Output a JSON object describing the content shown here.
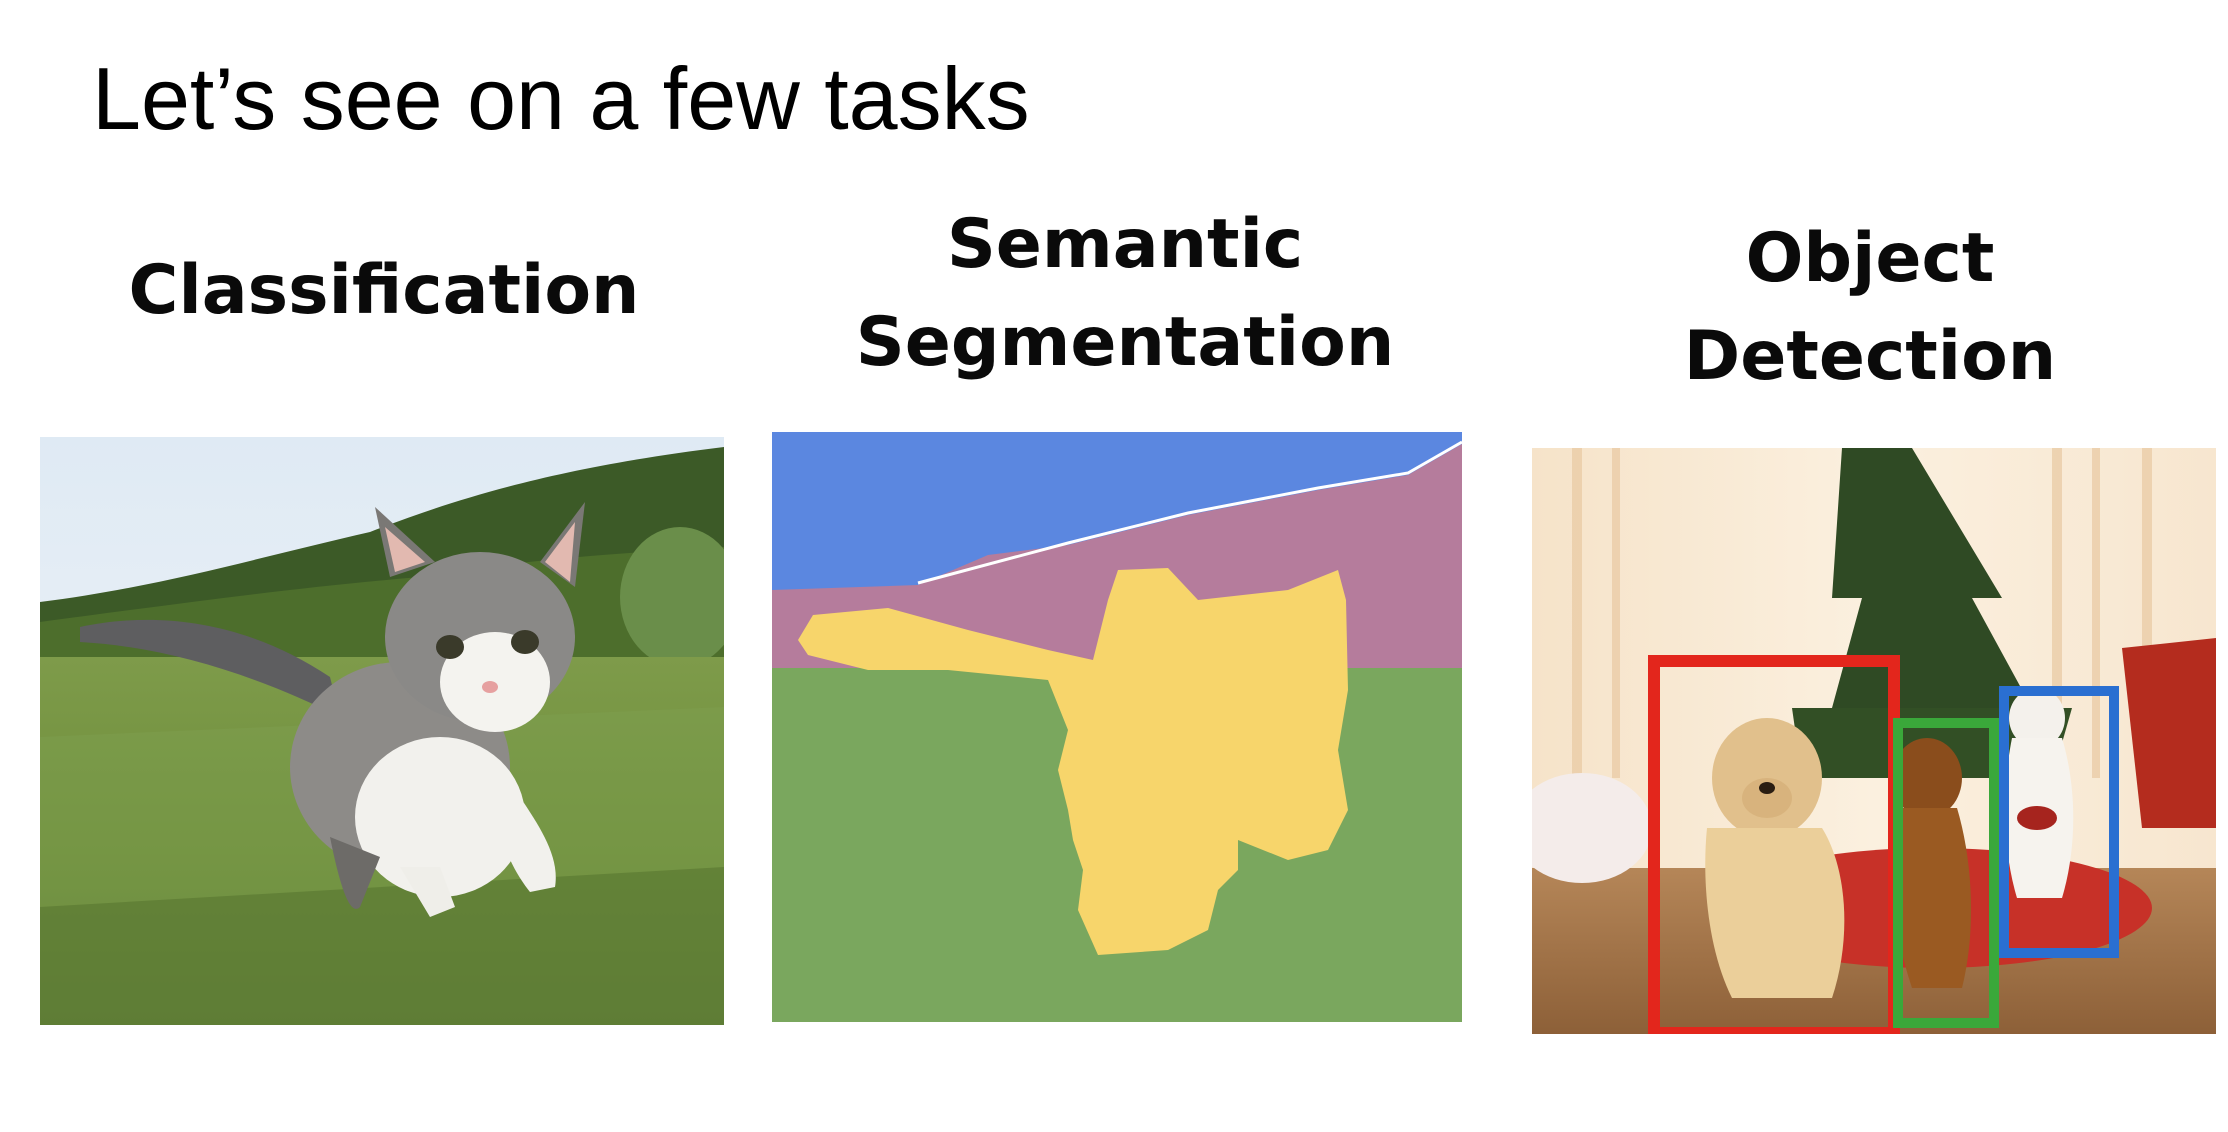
{
  "slide": {
    "title": "Let’s see on a few tasks"
  },
  "tasks": [
    {
      "label_lines": [
        "Classification"
      ]
    },
    {
      "label_lines": [
        "Semantic",
        "Segmentation"
      ]
    },
    {
      "label_lines": [
        "Object",
        "Detection"
      ]
    }
  ],
  "colors": {
    "segmentation_sky": "#5b87e0",
    "segmentation_mountain": "#b57c9c",
    "segmentation_grass": "#7aa75e",
    "segmentation_cat": "#f7d56b",
    "detection_box_dog1": "#e3261c",
    "detection_box_dog2": "#3aa83a",
    "detection_box_cat": "#2a6fd1"
  },
  "images": {
    "classification": "kitten-photo",
    "segmentation": "segmentation-mask",
    "detection": "pets-christmas-photo"
  }
}
